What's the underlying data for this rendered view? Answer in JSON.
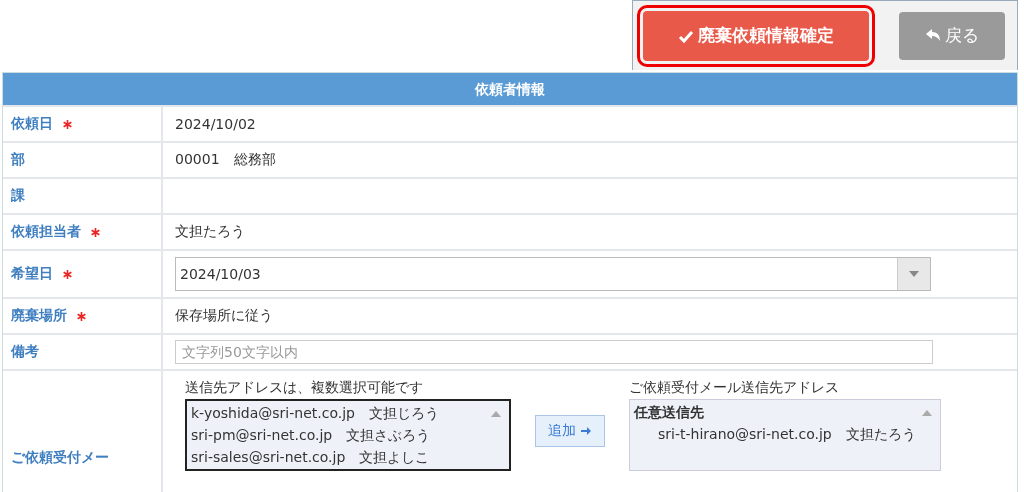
{
  "toolbar": {
    "confirm_button": "廃棄依頼情報確定",
    "back_button": "戻る"
  },
  "section": {
    "title": "依頼者情報",
    "rows": [
      {
        "kind": "text",
        "label": "依頼日",
        "required": true,
        "value": "2024/10/02"
      },
      {
        "kind": "text",
        "label": "部",
        "required": false,
        "value": "00001　総務部"
      },
      {
        "kind": "text",
        "label": "課",
        "required": false,
        "value": ""
      },
      {
        "kind": "text",
        "label": "依頼担当者",
        "required": true,
        "value": "文担たろう"
      },
      {
        "kind": "select",
        "label": "希望日",
        "required": true,
        "value": "2024/10/03"
      },
      {
        "kind": "text",
        "label": "廃棄場所",
        "required": true,
        "value": "保存場所に従う"
      },
      {
        "kind": "input",
        "label": "備考",
        "required": false,
        "placeholder": "文字列50文字以内"
      }
    ],
    "mail": {
      "label": "ご依頼受付メー",
      "left_caption": "送信先アドレスは、複数選択可能です",
      "left_items": [
        "k-yoshida@sri-net.co.jp　文担じろう",
        "sri-pm@sri-net.co.jp　文担さぶろう",
        "sri-sales@sri-net.co.jp　文担よしこ"
      ],
      "add_button": "追加",
      "right_caption": "ご依頼受付メール送信先アドレス",
      "right_group": "任意送信先",
      "right_items": [
        "sri-t-hirano@sri-net.co.jp　文担たろう"
      ]
    }
  }
}
